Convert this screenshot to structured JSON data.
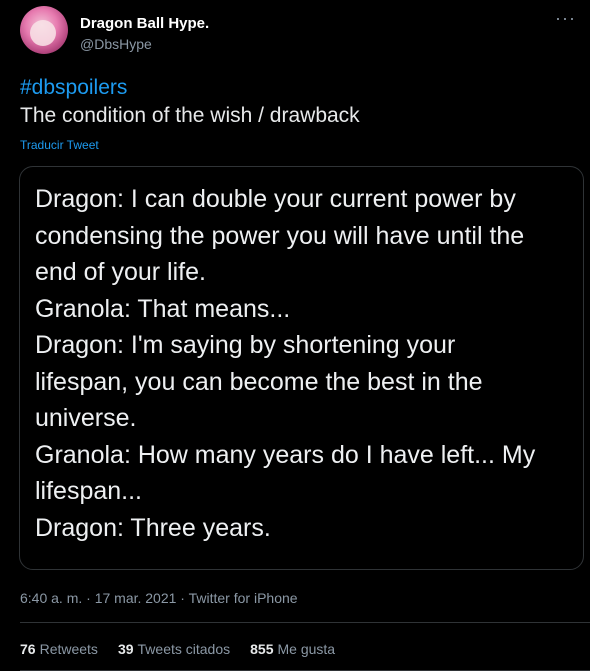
{
  "author": {
    "name": "Dragon Ball Hype.",
    "handle": "@DbsHype"
  },
  "more_icon": "ellipsis-icon",
  "tweet": {
    "hashtag": "#dbspoilers",
    "text": "The condition of the wish / drawback",
    "translate_label": "Traducir Tweet"
  },
  "card": {
    "lines": [
      "Dragon: I can double your current power by",
      "condensing the power you will have until the",
      "end of your life.",
      "Granola: That means...",
      "Dragon: I'm saying by shortening your",
      "lifespan, you can become the best in the",
      "universe.",
      "Granola: How many years do I have left... My",
      "lifespan...",
      "Dragon: Three years."
    ]
  },
  "meta": {
    "text": "6:40 a. m. · 17 mar. 2021 · Twitter for iPhone"
  },
  "stats": {
    "retweets_count": "76",
    "retweets_label": "Retweets",
    "quotes_count": "39",
    "quotes_label": "Tweets citados",
    "likes_count": "855",
    "likes_label": "Me gusta"
  },
  "colors": {
    "background": "#000000",
    "link": "#1d9bf0",
    "muted": "#8b98a5",
    "border": "#2f3336"
  }
}
